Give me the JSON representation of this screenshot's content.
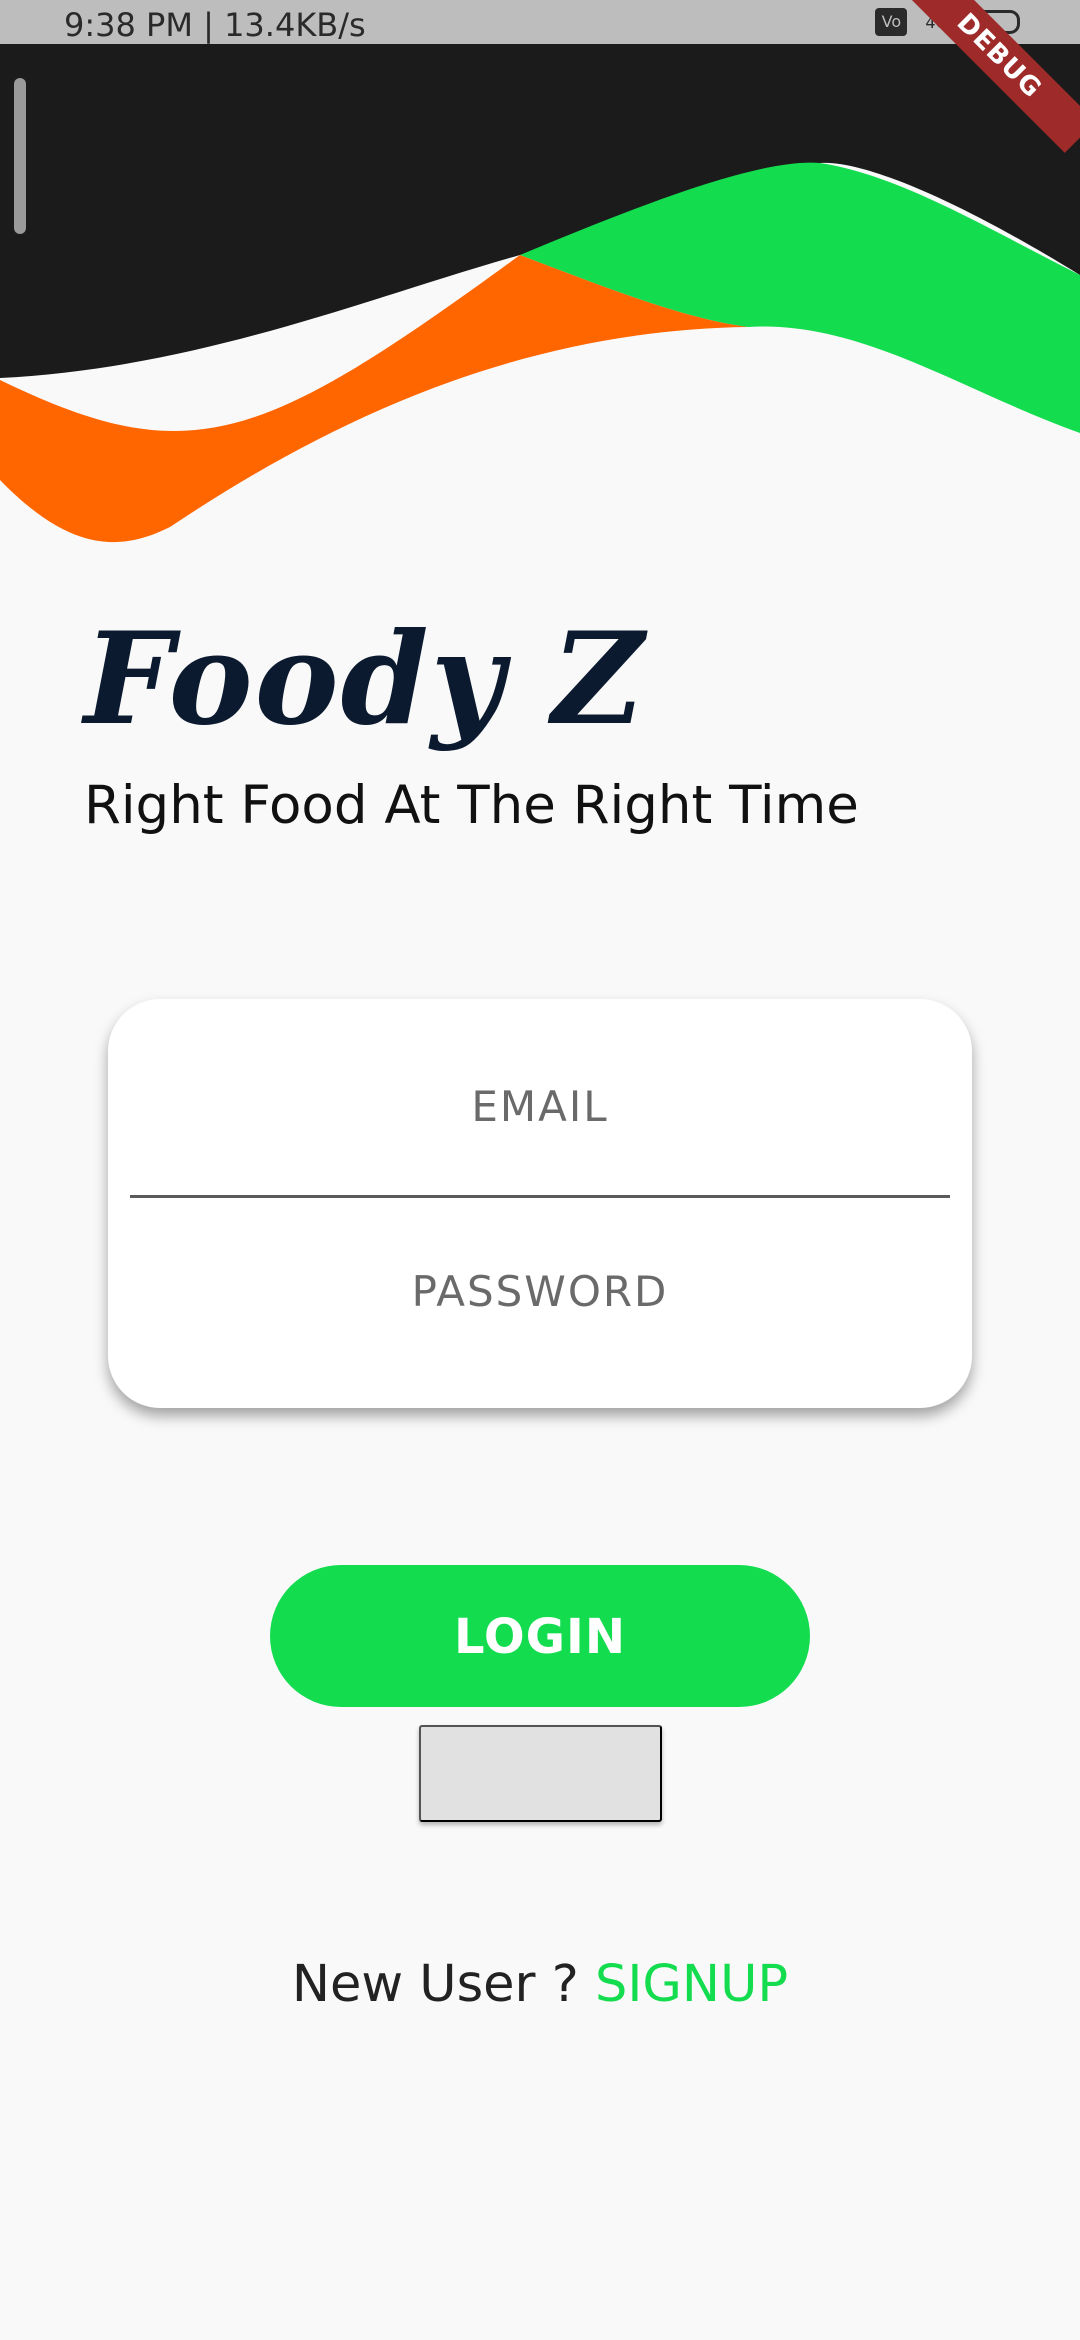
{
  "status_bar": {
    "time_text": "9:38 PM | 13.4KB/s",
    "volte_label": "Vo",
    "network_label": "4G"
  },
  "debug_banner": "DEBUG",
  "app": {
    "title": "Foody Z",
    "subtitle": "Right Food At The Right Time"
  },
  "form": {
    "email_placeholder": "EMAIL",
    "password_placeholder": "PASSWORD",
    "login_label": "LOGIN",
    "secondary_button_label": ""
  },
  "signup": {
    "prompt": "New User ? ",
    "link_label": "SIGNUP"
  },
  "colors": {
    "header_dark": "#1b1b1b",
    "wave_orange": "#ff6600",
    "wave_green": "#13dc4f",
    "accent_green": "#13dc4f",
    "title_navy": "#0b1a2e",
    "background": "#f9f9f9"
  }
}
